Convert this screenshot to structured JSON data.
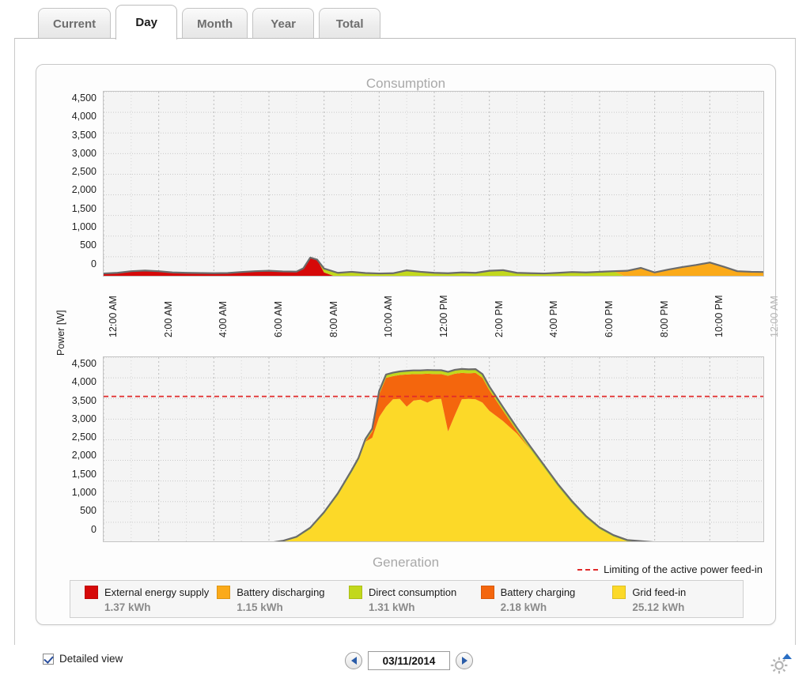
{
  "tabs": [
    {
      "label": "Current",
      "active": false
    },
    {
      "label": "Day",
      "active": true
    },
    {
      "label": "Month",
      "active": false
    },
    {
      "label": "Year",
      "active": false
    },
    {
      "label": "Total",
      "active": false
    }
  ],
  "charts": {
    "consumption_title": "Consumption",
    "generation_title": "Generation",
    "yaxis_title": "Power [W]",
    "limit_note": "Limiting of the active power feed-in"
  },
  "legend": [
    {
      "label": "External energy supply",
      "value": "1.37 kWh",
      "color": "#d60909"
    },
    {
      "label": "Battery discharging",
      "value": "1.15 kWh",
      "color": "#fbaa19"
    },
    {
      "label": "Direct consumption",
      "value": "1.31 kWh",
      "color": "#c2d81c"
    },
    {
      "label": "Battery charging",
      "value": "2.18 kWh",
      "color": "#f4660d"
    },
    {
      "label": "Grid feed-in",
      "value": "25.12 kWh",
      "color": "#fcd928"
    }
  ],
  "footer": {
    "detailed_view_label": "Detailed view",
    "detailed_view_checked": true,
    "date_value": "03/11/2014",
    "prev_icon": "left-arrow-icon",
    "next_icon": "right-arrow-icon",
    "settings_icon": "gear-icon"
  },
  "chart_data": [
    {
      "type": "area",
      "title": "Consumption",
      "xlabel": "",
      "ylabel": "Power [W]",
      "ylim": [
        0,
        4500
      ],
      "ytick_labels": [
        "4,500",
        "4,000",
        "3,500",
        "3,000",
        "2,500",
        "2,000",
        "1,500",
        "1,000",
        "500",
        "0"
      ],
      "xtick_labels": [
        "12:00 AM",
        "2:00 AM",
        "4:00 AM",
        "6:00 AM",
        "8:00 AM",
        "10:00 AM",
        "12:00 PM",
        "2:00 PM",
        "4:00 PM",
        "6:00 PM",
        "8:00 PM",
        "10:00 PM",
        "12:00 AM"
      ],
      "grid": true,
      "legend_position": "bottom",
      "x": [
        0,
        0.5,
        1,
        1.5,
        2,
        2.5,
        3,
        3.5,
        4,
        4.5,
        5,
        5.5,
        6,
        6.5,
        7,
        7.25,
        7.5,
        7.75,
        8,
        8.5,
        9,
        9.5,
        10,
        10.5,
        11,
        11.5,
        12,
        12.5,
        13,
        13.5,
        14,
        14.5,
        15,
        15.5,
        16,
        16.5,
        17,
        17.5,
        18,
        18.5,
        19,
        19.5,
        20,
        20.5,
        21,
        21.5,
        22,
        22.5,
        23,
        23.5,
        24
      ],
      "series": [
        {
          "name": "External energy supply",
          "color": "#d60909",
          "values": [
            95,
            110,
            150,
            165,
            150,
            120,
            110,
            105,
            100,
            105,
            130,
            150,
            160,
            145,
            140,
            220,
            480,
            430,
            120,
            0,
            0,
            0,
            0,
            0,
            0,
            0,
            0,
            0,
            0,
            0,
            0,
            0,
            0,
            0,
            0,
            0,
            0,
            0,
            0,
            0,
            0,
            0,
            0,
            0,
            0,
            0,
            0,
            0,
            0,
            0,
            0
          ]
        },
        {
          "name": "Direct consumption",
          "color": "#c2d81c",
          "values": [
            0,
            0,
            0,
            0,
            0,
            0,
            0,
            0,
            0,
            0,
            0,
            0,
            0,
            0,
            0,
            0,
            0,
            0,
            95,
            110,
            135,
            105,
            95,
            100,
            170,
            135,
            110,
            100,
            120,
            110,
            160,
            175,
            110,
            100,
            95,
            110,
            130,
            120,
            135,
            150,
            0,
            0,
            0,
            0,
            0,
            0,
            0,
            0,
            0,
            0,
            0
          ]
        },
        {
          "name": "Battery discharging",
          "color": "#fbaa19",
          "values": [
            0,
            0,
            0,
            0,
            0,
            0,
            0,
            0,
            0,
            0,
            0,
            0,
            0,
            0,
            0,
            0,
            0,
            0,
            0,
            0,
            0,
            0,
            0,
            0,
            0,
            0,
            0,
            0,
            0,
            0,
            0,
            0,
            0,
            0,
            0,
            0,
            0,
            0,
            0,
            0,
            160,
            230,
            120,
            190,
            250,
            300,
            360,
            260,
            150,
            135,
            130
          ]
        }
      ],
      "annotations": []
    },
    {
      "type": "area",
      "title": "Generation",
      "xlabel": "",
      "ylabel": "Power [W]",
      "ylim": [
        0,
        4500
      ],
      "ytick_labels": [
        "4,500",
        "4,000",
        "3,500",
        "3,000",
        "2,500",
        "2,000",
        "1,500",
        "1,000",
        "500",
        "0"
      ],
      "grid": true,
      "legend_position": "bottom",
      "x": [
        0,
        1,
        2,
        3,
        4,
        5,
        6,
        6.5,
        7,
        7.5,
        8,
        8.5,
        9,
        9.25,
        9.5,
        9.75,
        10,
        10.25,
        10.5,
        10.75,
        11,
        11.25,
        11.5,
        11.75,
        12,
        12.25,
        12.5,
        12.75,
        13,
        13.25,
        13.5,
        13.75,
        14,
        14.5,
        15,
        15.5,
        16,
        16.5,
        17,
        17.5,
        18,
        18.5,
        19,
        20,
        21,
        22,
        23,
        24
      ],
      "series": [
        {
          "name": "Grid feed-in",
          "color": "#fcd928",
          "values": [
            0,
            0,
            0,
            0,
            0,
            0,
            0,
            30,
            120,
            330,
            700,
            1150,
            1700,
            2000,
            2450,
            2550,
            3050,
            3300,
            3480,
            3490,
            3300,
            3450,
            3470,
            3400,
            3480,
            3490,
            2700,
            3100,
            3480,
            3490,
            3480,
            3400,
            3200,
            2950,
            2650,
            2250,
            1800,
            1350,
            950,
            600,
            330,
            150,
            40,
            0,
            0,
            0,
            0,
            0
          ]
        },
        {
          "name": "Battery charging",
          "color": "#f4660d",
          "values": [
            0,
            0,
            0,
            0,
            0,
            0,
            0,
            0,
            0,
            0,
            0,
            0,
            0,
            0,
            0,
            150,
            550,
            700,
            560,
            580,
            780,
            640,
            620,
            700,
            610,
            600,
            1350,
            1000,
            640,
            620,
            640,
            600,
            500,
            250,
            60,
            0,
            0,
            0,
            0,
            0,
            0,
            0,
            0,
            0,
            0,
            0,
            0,
            0
          ]
        },
        {
          "name": "Direct consumption",
          "color": "#c2d81c",
          "values": [
            0,
            0,
            0,
            0,
            0,
            0,
            0,
            20,
            30,
            40,
            45,
            50,
            60,
            60,
            65,
            70,
            80,
            80,
            85,
            85,
            90,
            90,
            90,
            90,
            95,
            95,
            95,
            95,
            95,
            95,
            90,
            90,
            90,
            85,
            80,
            75,
            70,
            65,
            60,
            55,
            45,
            40,
            30,
            15,
            0,
            0,
            0,
            0
          ]
        }
      ],
      "annotations": [
        {
          "type": "hline",
          "value": 3550,
          "color": "#e12b2b",
          "style": "dashed",
          "label": "Limiting of the active power feed-in"
        }
      ]
    }
  ]
}
